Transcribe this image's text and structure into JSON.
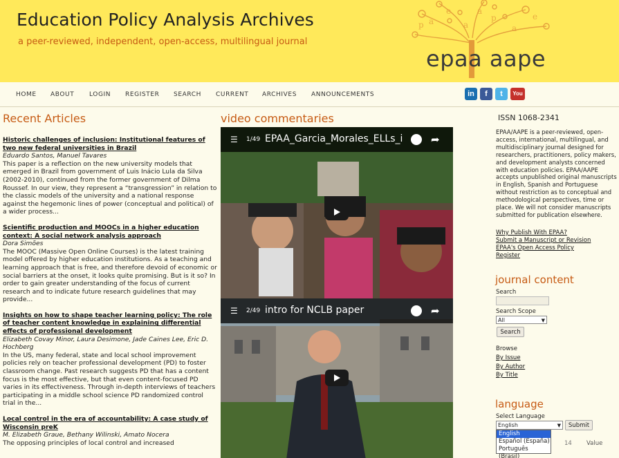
{
  "header": {
    "title": "Education Policy Analysis Archives",
    "subtitle": "a peer-reviewed, independent, open-access, multilingual journal",
    "logo_text": "epaa aape"
  },
  "nav": {
    "items": [
      "HOME",
      "ABOUT",
      "LOGIN",
      "REGISTER",
      "SEARCH",
      "CURRENT",
      "ARCHIVES",
      "ANNOUNCEMENTS"
    ]
  },
  "social": {
    "linkedin": "in",
    "facebook": "f",
    "twitter": "t",
    "youtube": "You"
  },
  "recent": {
    "title": "Recent Articles",
    "articles": [
      {
        "title": "Historic challenges of inclusion: Institutional features of two new federal universities in Brazil",
        "authors": "Eduardo Santos, Manuel Tavares",
        "abstract": "This paper is a reflection on the new university models that emerged in Brazil from government of Luis Inácio Lula da Silva (2002-2010), continued from the former government of Dilma Roussef. In our view, they represent a “transgression” in relation to the classic models of the university and a national response against the hegemonic lines of power (conceptual and political) of a wider process..."
      },
      {
        "title": "Scientific production and MOOCs in a higher education context: A social network analysis approach",
        "authors": "Dora Simões",
        "abstract": "The MOOC (Massive Open Online Courses) is the latest training model offered by higher education institutions. As a teaching and learning approach that is free, and therefore devoid of economic or social barriers at the onset, it looks quite promising. But is it so? In order to gain greater understanding of the focus of current research and to indicate future research guidelines that may provide..."
      },
      {
        "title": "Insights on how to shape teacher learning policy: The role of teacher content knowledge in explaining differential effects of professional development",
        "authors": "Elizabeth Covay Minor, Laura Desimone, Jade Caines Lee, Eric D. Hochberg",
        "abstract": "In the US, many federal, state and local school improvement policies rely on teacher professional development (PD) to foster classroom change. Past research suggests PD that has a content focus is the most effective, but that even content-focused PD varies in its effectiveness. Through in-depth interviews of teachers participating in a middle school science PD randomized control trial in the..."
      },
      {
        "title": "Local control in the era of accountability: A case study of Wisconsin preK",
        "authors": "M. Elizabeth Graue, Bethany Wilinski, Amato Nocera",
        "abstract": "The opposing principles of local control and increased"
      }
    ]
  },
  "videos": {
    "title": "video commentaries",
    "items": [
      {
        "count": "1/49",
        "title": "EPAA_Garcia_Morales_ELLs_i..."
      },
      {
        "count": "2/49",
        "title": "intro for NCLB paper"
      }
    ]
  },
  "sidebar": {
    "issn": "ISSN 1068-2341",
    "about": "EPAA/AAPE is a peer-reviewed, open-access, international, multilingual, and multidisciplinary journal designed for researchers, practitioners, policy makers, and development analysts concerned with education policies. EPAA/AAPE accepts unpublished original manuscripts in English, Spanish and Portuguese without restriction as to conceptual and methodological perspectives, time or place. We will not consider manuscripts submitted for publication elsewhere.",
    "links": [
      "Why Publish With EPAA?",
      "Submit a Manuscript or Revision",
      "EPAA's Open Access Policy",
      "Register"
    ],
    "journal_content": {
      "title": "journal content",
      "search_label": "Search",
      "scope_label": "Search Scope",
      "scope_value": "All",
      "search_button": "Search",
      "browse_label": "Browse",
      "browse_links": [
        "By Issue",
        "By Author",
        "By Title"
      ]
    },
    "language": {
      "title": "language",
      "select_label": "Select Language",
      "selected": "English",
      "submit": "Submit",
      "options": [
        "English",
        "Español (España)",
        "Português (Brasil)"
      ],
      "partial_text_a": "14",
      "partial_text_b": "Value"
    }
  },
  "colors": {
    "header_bg": "#ffe95a",
    "accent": "#c65a13",
    "page_bg": "#fdfbeb"
  }
}
